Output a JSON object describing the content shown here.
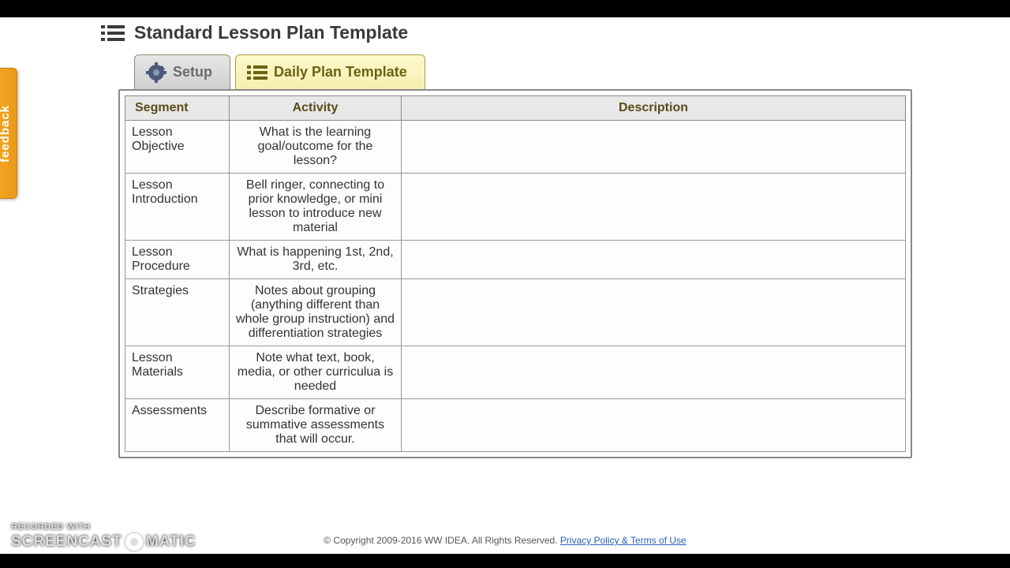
{
  "header": {
    "title": "Standard Lesson Plan Template"
  },
  "tabs": {
    "setup": "Setup",
    "daily": "Daily Plan Template"
  },
  "table": {
    "headers": {
      "segment": "Segment",
      "activity": "Activity",
      "description": "Description"
    },
    "rows": [
      {
        "segment": "Lesson Objective",
        "activity": "What is the learning goal/outcome for the lesson?",
        "description": ""
      },
      {
        "segment": "Lesson Introduction",
        "activity": "Bell ringer, connecting to prior knowledge, or mini lesson to introduce new material",
        "description": ""
      },
      {
        "segment": "Lesson Procedure",
        "activity": "What is happening 1st, 2nd, 3rd, etc.",
        "description": ""
      },
      {
        "segment": "Strategies",
        "activity": "Notes about grouping (anything different than whole group instruction) and differentiation strategies",
        "description": ""
      },
      {
        "segment": "Lesson Materials",
        "activity": "Note what text, book, media, or other curriculua is needed",
        "description": ""
      },
      {
        "segment": "Assessments",
        "activity": "Describe formative or summative assessments that will occur.",
        "description": ""
      }
    ]
  },
  "feedback": {
    "label": "feedback"
  },
  "footer": {
    "copyright": "© Copyright 2009-2016 WW IDEA. All Rights Reserved. ",
    "link": "Privacy Policy & Terms of Use"
  },
  "watermark": {
    "line1": "RECORDED WITH",
    "brand_left": "SCREENCAST",
    "brand_right": "MATIC"
  }
}
